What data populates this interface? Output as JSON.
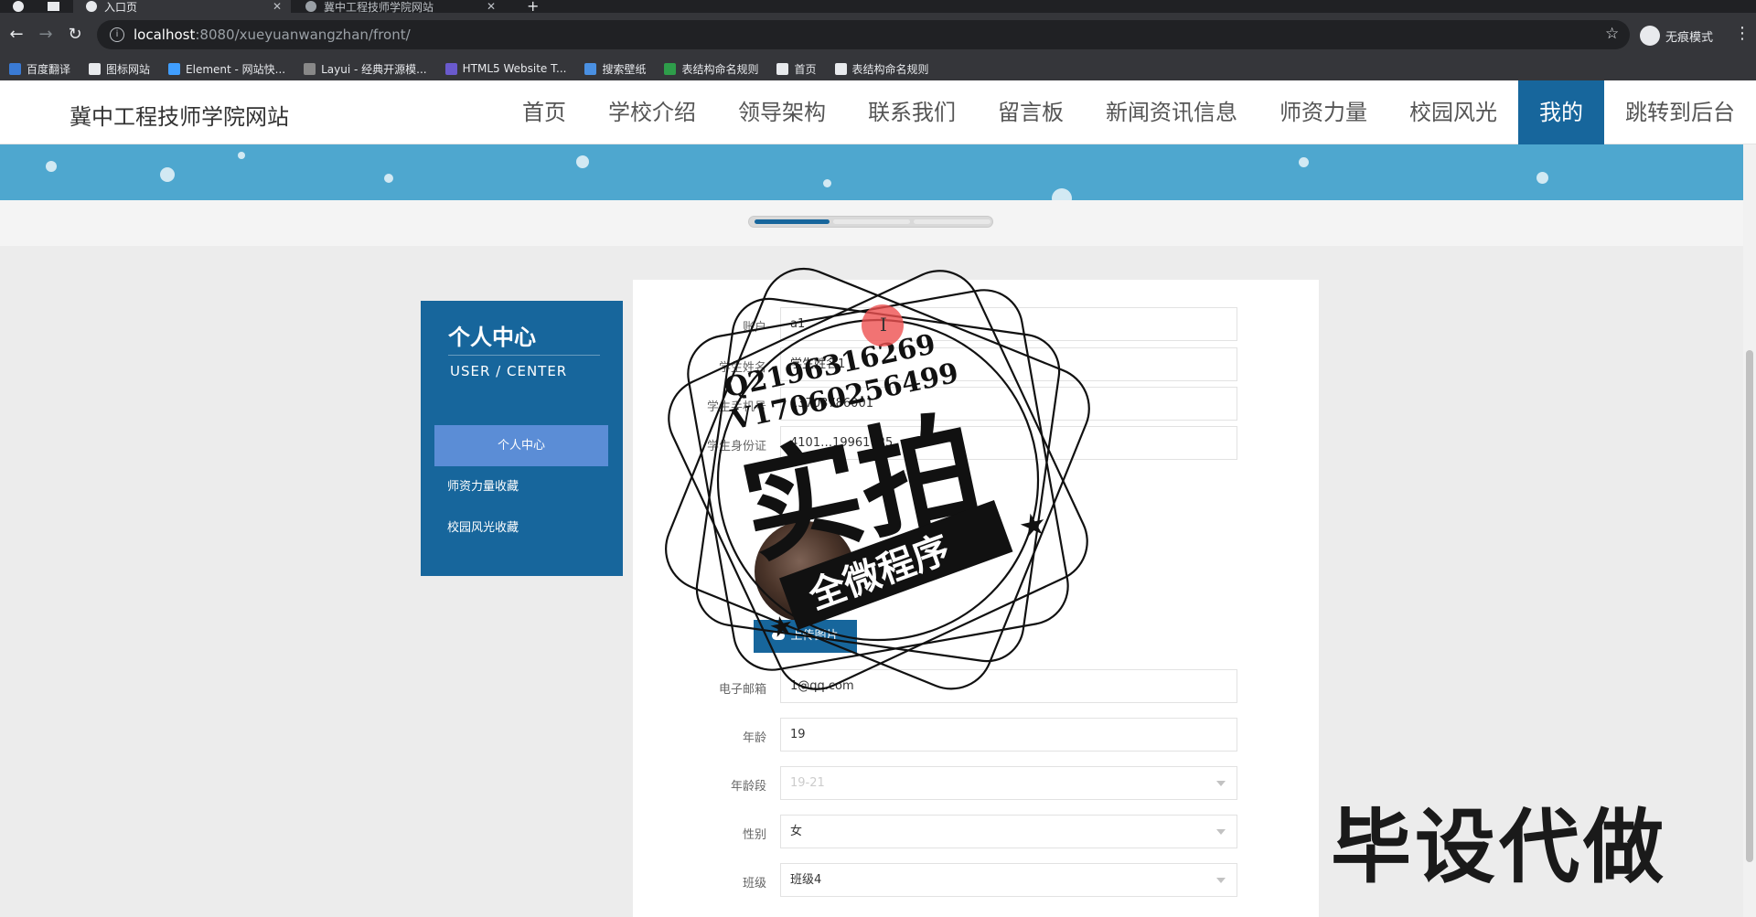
{
  "browser": {
    "tabs": [
      {
        "label": "入口页",
        "active": true
      },
      {
        "label": "冀中工程技师学院网站",
        "active": false
      }
    ],
    "url_host": "localhost",
    "url_path": ":8080/xueyuanwangzhan/front/",
    "incognito_label": "无痕模式",
    "bookmarks": [
      {
        "label": "百度翻译",
        "color": "#3a7bd5"
      },
      {
        "label": "图标网站",
        "color": "#e8eaed"
      },
      {
        "label": "Element - 网站快...",
        "color": "#409eff"
      },
      {
        "label": "Layui - 经典开源模...",
        "color": "#888888"
      },
      {
        "label": "HTML5 Website T...",
        "color": "#6a5acd"
      },
      {
        "label": "搜索壁纸",
        "color": "#4a90e2"
      },
      {
        "label": "表结构命名规则",
        "color": "#2e9d4a"
      },
      {
        "label": "首页",
        "color": "#e8eaed"
      },
      {
        "label": "表结构命名规则",
        "color": "#e8eaed"
      }
    ]
  },
  "site": {
    "title": "冀中工程技师学院网站",
    "nav": [
      "首页",
      "学校介绍",
      "领导架构",
      "联系我们",
      "留言板",
      "新闻资讯信息",
      "师资力量",
      "校园风光",
      "我的",
      "跳转到后台"
    ],
    "active_nav": 8
  },
  "sidebar": {
    "title": "个人中心",
    "subtitle": "USER / CENTER",
    "items": [
      "个人中心",
      "师资力量收藏",
      "校园风光收藏"
    ]
  },
  "form": {
    "fields": [
      {
        "label": "账户",
        "value": "a1"
      },
      {
        "label": "学生姓名",
        "value": "学生姓名1"
      },
      {
        "label": "学生手机号",
        "value": "13703786001"
      },
      {
        "label": "学生身份证",
        "value": "4101…19961025"
      }
    ],
    "upload_label": "上传图片",
    "fields2": [
      {
        "label": "电子邮箱",
        "value": "1@qq.com",
        "type": "input"
      },
      {
        "label": "年龄",
        "value": "19",
        "type": "input"
      },
      {
        "label": "年龄段",
        "value": "19-21",
        "type": "select",
        "placeholder": true
      },
      {
        "label": "性别",
        "value": "女",
        "type": "select"
      },
      {
        "label": "班级",
        "value": "班级4",
        "type": "select"
      }
    ]
  },
  "watermark": {
    "line1": "Q2196316269",
    "line2": "V17060256499",
    "big": "实拍",
    "banner": "全微程序",
    "bottom": "毕设代做"
  },
  "colors": {
    "primary": "#17669c",
    "sidebar_active": "#5b8dd6",
    "banner": "#4ea7cf"
  }
}
